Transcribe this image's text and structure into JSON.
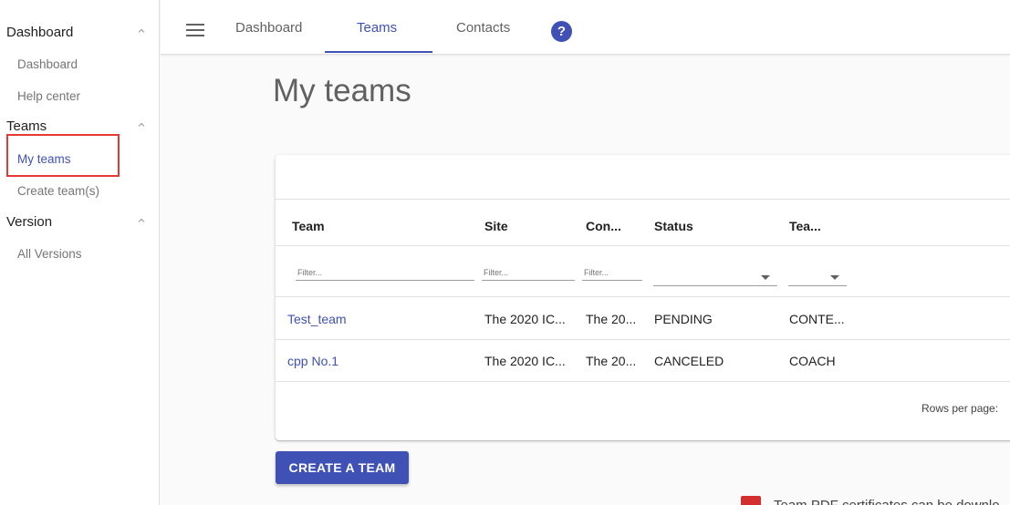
{
  "sidebar": {
    "sections": [
      {
        "label": "Dashboard",
        "items": [
          "Dashboard",
          "Help center"
        ]
      },
      {
        "label": "Teams",
        "items": [
          "My teams",
          "Create team(s)"
        ]
      },
      {
        "label": "Version",
        "items": [
          "All Versions"
        ]
      }
    ],
    "active_item": "My teams"
  },
  "topnav": {
    "tabs": [
      "Dashboard",
      "Teams",
      "Contacts"
    ],
    "active_tab": "Teams",
    "help_glyph": "?"
  },
  "page": {
    "title": "My teams"
  },
  "table": {
    "columns": [
      "Team",
      "Site",
      "Con...",
      "Status",
      "Tea..."
    ],
    "filter_placeholders": [
      "Filter...",
      "Filter...",
      "Filter..."
    ],
    "rows": [
      {
        "team": "Test_team",
        "site": "The 2020 IC...",
        "con": "The 20...",
        "status": "PENDING",
        "tea": "CONTE..."
      },
      {
        "team": "cpp No.1",
        "site": "The 2020 IC...",
        "con": "The 20...",
        "status": "CANCELED",
        "tea": "COACH"
      }
    ],
    "rows_per_page_label": "Rows per page:"
  },
  "actions": {
    "create_team": "CREATE A TEAM"
  },
  "footer_note": "Team PDF certificates can be downlo",
  "colors": {
    "primary": "#3f51b5",
    "highlight": "#e53935",
    "pdf": "#d32f2f"
  }
}
